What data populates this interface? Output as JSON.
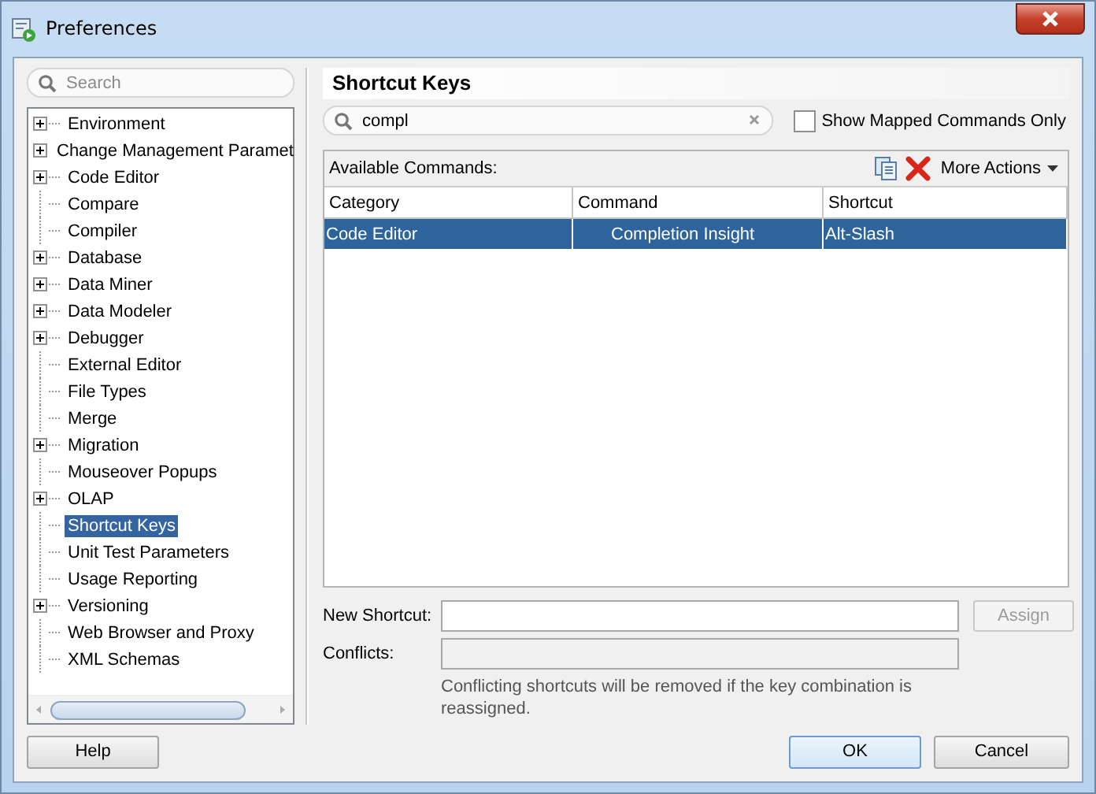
{
  "window": {
    "title": "Preferences"
  },
  "sidebar": {
    "search": {
      "placeholder": "Search"
    },
    "items": [
      {
        "label": "Environment",
        "expandable": true,
        "selected": false
      },
      {
        "label": "Change Management Paramet",
        "expandable": true,
        "selected": false
      },
      {
        "label": "Code Editor",
        "expandable": true,
        "selected": false
      },
      {
        "label": "Compare",
        "expandable": false,
        "selected": false
      },
      {
        "label": "Compiler",
        "expandable": false,
        "selected": false
      },
      {
        "label": "Database",
        "expandable": true,
        "selected": false
      },
      {
        "label": "Data Miner",
        "expandable": true,
        "selected": false
      },
      {
        "label": "Data Modeler",
        "expandable": true,
        "selected": false
      },
      {
        "label": "Debugger",
        "expandable": true,
        "selected": false
      },
      {
        "label": "External Editor",
        "expandable": false,
        "selected": false
      },
      {
        "label": "File Types",
        "expandable": false,
        "selected": false
      },
      {
        "label": "Merge",
        "expandable": false,
        "selected": false
      },
      {
        "label": "Migration",
        "expandable": true,
        "selected": false
      },
      {
        "label": "Mouseover Popups",
        "expandable": false,
        "selected": false
      },
      {
        "label": "OLAP",
        "expandable": true,
        "selected": false
      },
      {
        "label": "Shortcut Keys",
        "expandable": false,
        "selected": true
      },
      {
        "label": "Unit Test Parameters",
        "expandable": false,
        "selected": false
      },
      {
        "label": "Usage Reporting",
        "expandable": false,
        "selected": false
      },
      {
        "label": "Versioning",
        "expandable": true,
        "selected": false
      },
      {
        "label": "Web Browser and Proxy",
        "expandable": false,
        "selected": false
      },
      {
        "label": "XML Schemas",
        "expandable": false,
        "selected": false
      }
    ]
  },
  "panel": {
    "title": "Shortcut Keys",
    "filter": {
      "value": "compl"
    },
    "show_mapped_only": {
      "label": "Show Mapped Commands Only",
      "checked": false
    },
    "available_label": "Available Commands:",
    "more_actions": "More Actions",
    "table": {
      "columns": [
        "Category",
        "Command",
        "Shortcut"
      ],
      "rows": [
        {
          "cells": [
            "Code Editor",
            "Completion Insight",
            "Alt-Slash"
          ],
          "selected": true
        }
      ]
    },
    "new_shortcut_label": "New Shortcut:",
    "assign": {
      "label": "Assign",
      "disabled": true
    },
    "conflicts_label": "Conflicts:",
    "note": "Conflicting shortcuts will be removed if the key combination is reassigned."
  },
  "buttons": {
    "help": "Help",
    "ok": "OK",
    "cancel": "Cancel"
  }
}
